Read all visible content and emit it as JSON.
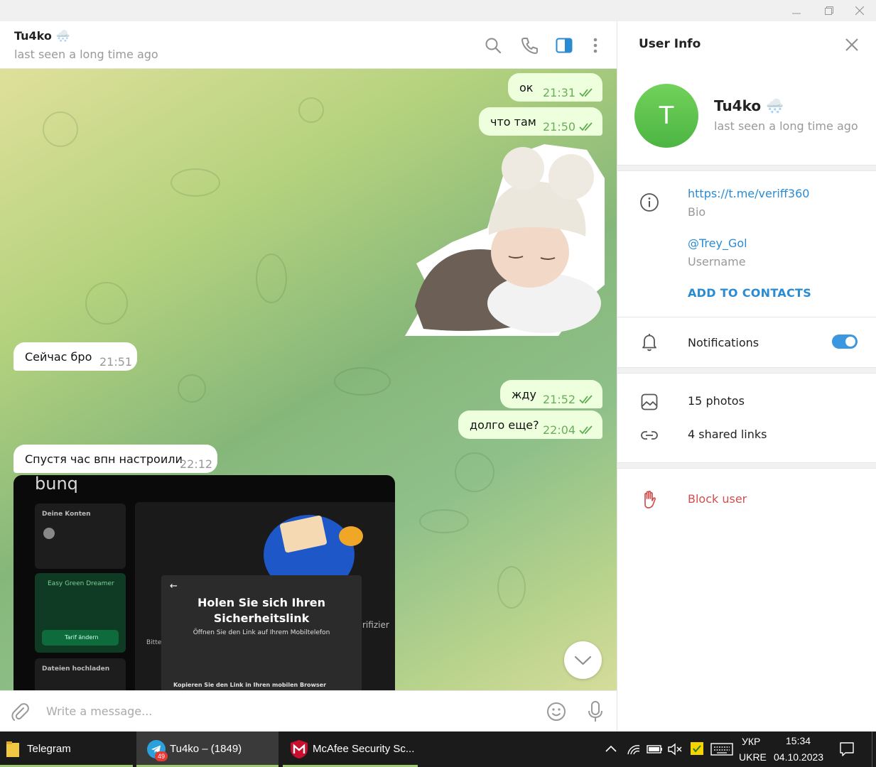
{
  "header": {
    "contact_name": "Tu4ko 🌨️",
    "status": "last seen a long time ago"
  },
  "messages": [
    {
      "direction": "out",
      "text": "ок",
      "time": "21:31",
      "read": true
    },
    {
      "direction": "out",
      "text": "что там",
      "time": "21:50",
      "read": true
    },
    {
      "direction": "out",
      "type": "sticker",
      "description": "sleeping baby sticker"
    },
    {
      "direction": "in",
      "text": "Сейчас бро",
      "time": "21:51"
    },
    {
      "direction": "out",
      "text": "жду",
      "time": "21:52",
      "read": true
    },
    {
      "direction": "out",
      "text": "долго еще?",
      "time": "22:04",
      "read": true
    },
    {
      "direction": "in",
      "text": "Спустя час впн настроили",
      "time": "22:12"
    }
  ],
  "photo": {
    "brand": "bunq",
    "dialog_title_line1": "Holen Sie sich Ihren",
    "dialog_title_line2": "Sicherheitslink",
    "dialog_subtitle": "Öffnen Sie den Link auf Ihrem Mobiltelefon",
    "dialog_footer": "Kopieren Sie den Link in Ihren mobilen Browser",
    "left_panel_title": "Deine Konten",
    "left_panel_bottom": "Dateien hochladen",
    "green_panel_title": "Easy Green Dreamer",
    "green_panel_button": "Tarif ändern",
    "side_text_1": "rifizier",
    "side_text_2": "Bitte"
  },
  "input": {
    "placeholder": "Write a message..."
  },
  "user_info": {
    "title": "User Info",
    "avatar_letter": "T",
    "name": "Tu4ko 🌨️",
    "status": "last seen a long time ago",
    "bio_value": "https://t.me/veriff360",
    "bio_label": "Bio",
    "username_value": "@Trey_Gol",
    "username_label": "Username",
    "add_contacts": "ADD TO CONTACTS",
    "notifications": "Notifications",
    "notifications_on": true,
    "photos": "15 photos",
    "shared_links": "4 shared links",
    "block_user": "Block user"
  },
  "taskbar": {
    "items": [
      {
        "label": "Telegram"
      },
      {
        "label": "Tu4ko – (1849)",
        "badge": "49"
      },
      {
        "label": "McAfee Security Sc..."
      }
    ],
    "language_top": "УКР",
    "language_bottom": "UKRE",
    "clock_time": "15:34",
    "clock_date": "04.10.2023"
  },
  "colors": {
    "outgoing_bubble": "#eeffde",
    "incoming_bubble": "#ffffff",
    "accent": "#2a8bd2",
    "danger": "#d14e4e",
    "avatar_green": "#4cb543"
  }
}
